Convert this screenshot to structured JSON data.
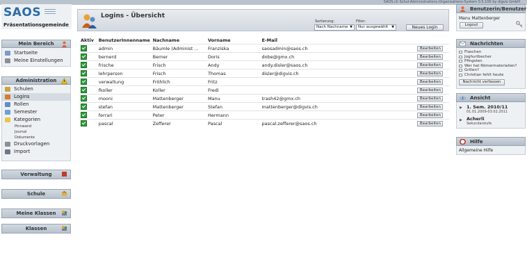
{
  "app": {
    "header_info": "SAOS.ch Schul-Administrations-Organisations-System 0.5.100 by digvis GmbH",
    "logo_text": "SAOS",
    "school_name": "Präsentationsgemeinde"
  },
  "sidebar": {
    "mein_bereich": {
      "title": "Mein Bereich",
      "items": [
        {
          "label": "Startseite",
          "icon": "home-icon"
        },
        {
          "label": "Meine Einstellungen",
          "icon": "settings-icon"
        }
      ]
    },
    "administration": {
      "title": "Administration",
      "items": [
        {
          "label": "Schulen",
          "icon": "school-icon"
        },
        {
          "label": "Logins",
          "icon": "users-icon"
        },
        {
          "label": "Rollen",
          "icon": "roles-icon"
        },
        {
          "label": "Semester",
          "icon": "calendar-icon"
        },
        {
          "label": "Kategorien",
          "icon": "folder-icon"
        },
        {
          "label": "Pinnwand"
        },
        {
          "label": "Journal"
        },
        {
          "label": "Dokumente"
        },
        {
          "label": "Druckvorlagen",
          "icon": "print-icon"
        },
        {
          "label": "Import",
          "icon": "import-icon"
        }
      ]
    },
    "collapsed": [
      {
        "title": "Verwaltung"
      },
      {
        "title": "Schule"
      },
      {
        "title": "Meine Klassen"
      },
      {
        "title": "Klassen"
      }
    ]
  },
  "main": {
    "title": "Logins - Übersicht",
    "sort_label": "Sortierung:",
    "sort_value": "Nach Nachname",
    "filter_label": "Filter:",
    "filter_value": "Nur ausgewählt",
    "new_login_button": "Neues Login",
    "edit_label": "Bearbeiten",
    "columns": [
      "Aktiv",
      "BenutzerInnenname",
      "Nachname",
      "Vorname",
      "E-Mail"
    ],
    "rows": [
      {
        "user": "admin",
        "last": "Bäumle (Administ ...",
        "first": "Franziska",
        "email": "saosadmin@saos.ch"
      },
      {
        "user": "bernerd",
        "last": "Berner",
        "first": "Doris",
        "email": "dobe@gmx.ch"
      },
      {
        "user": "frische",
        "last": "Frisch",
        "first": "Andy",
        "email": "andy.disler@saos.ch"
      },
      {
        "user": "lehrperson",
        "last": "Frisch",
        "first": "Thomas",
        "email": "disler@digvis.ch"
      },
      {
        "user": "verwaltung",
        "last": "Fröhlich",
        "first": "Fritz",
        "email": ""
      },
      {
        "user": "fkoller",
        "last": "Koller",
        "first": "Fredi",
        "email": ""
      },
      {
        "user": "mooni",
        "last": "Mattenberger",
        "first": "Manu",
        "email": "trash42@gmx.ch"
      },
      {
        "user": "stefan",
        "last": "Mattenberger",
        "first": "Stefan",
        "email": "mattenberger@digvis.ch"
      },
      {
        "user": "ferrari",
        "last": "Peter",
        "first": "Hermann",
        "email": ""
      },
      {
        "user": "pascal",
        "last": "Zefferer",
        "first": "Pascal",
        "email": "pascal.zefferer@saos.ch"
      }
    ]
  },
  "right": {
    "user_panel": {
      "title": "Benutzerin/Benutzer",
      "name": "Manu Mattenberger",
      "logout": "Logout"
    },
    "messages": {
      "title": "Nachrichten",
      "items": [
        "Flaschen",
        "Joghurtbecher",
        "Pfingsten",
        "Wer hat Römermaterialien?",
        "Grillen?",
        "Christian fehlt heute"
      ],
      "compose": "Nachricht verfassen"
    },
    "view": {
      "title": "Ansicht",
      "semester": "1. Sem. 2010/11",
      "semester_dates": "01.01.2009-03.02.2011",
      "school": "Acherli",
      "level": "Sekundarstufe"
    },
    "help": {
      "title": "Hilfe",
      "link": "Allgemeine Hilfe"
    }
  },
  "colors": {
    "accent": "#2d6ca8",
    "panel": "#eef1f4",
    "header": "#b8c2cd",
    "check": "#2f9a3b"
  }
}
